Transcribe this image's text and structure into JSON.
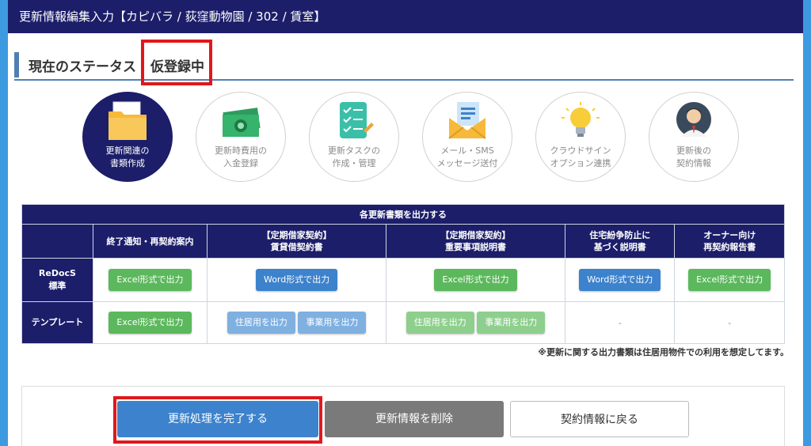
{
  "header": {
    "title": "更新情報編集入力【カピバラ / 荻窪動物園 / 302 / 賃室】"
  },
  "status": {
    "label": "現在のステータス",
    "value": "仮登録中"
  },
  "steps": [
    {
      "line1": "更新関連の",
      "line2": "書類作成",
      "icon": "folder-icon",
      "active": true
    },
    {
      "line1": "更新時費用の",
      "line2": "入金登録",
      "icon": "money-icon"
    },
    {
      "line1": "更新タスクの",
      "line2": "作成・管理",
      "icon": "checklist-icon"
    },
    {
      "line1": "メール・SMS",
      "line2": "メッセージ送付",
      "icon": "mail-icon"
    },
    {
      "line1": "クラウドサイン",
      "line2": "オプション連携",
      "icon": "lightbulb-icon"
    },
    {
      "line1": "更新後の",
      "line2": "契約情報",
      "icon": "person-icon"
    }
  ],
  "table": {
    "caption": "各更新書類を出力する",
    "columns": [
      {
        "line1": "終了通知・再契約案内",
        "line2": ""
      },
      {
        "line1": "【定期借家契約】",
        "line2": "賃貸借契約書"
      },
      {
        "line1": "【定期借家契約】",
        "line2": "重要事項説明書"
      },
      {
        "line1": "住宅紛争防止に",
        "line2": "基づく説明書"
      },
      {
        "line1": "オーナー向け",
        "line2": "再契約報告書"
      }
    ],
    "rows": [
      {
        "head1": "ReDocS",
        "head2": "標準",
        "cells": [
          "Excel形式で出力",
          "Word形式で出力",
          "Excel形式で出力",
          "Word形式で出力",
          "Excel形式で出力"
        ]
      },
      {
        "head1": "テンプレート",
        "head2": "",
        "c1": "Excel形式で出力",
        "c2a": "住居用を出力",
        "c2b": "事業用を出力",
        "c3a": "住居用を出力",
        "c3b": "事業用を出力",
        "c4": "-",
        "c5": "-"
      }
    ],
    "note": "※更新に関する出力書類は住居用物件での利用を想定してます。"
  },
  "footer": {
    "complete": "更新処理を完了する",
    "delete": "更新情報を削除",
    "back": "契約情報に戻る"
  },
  "colors": {
    "navy": "#1c1e6a",
    "accent_red": "#e0181b",
    "green": "#5cb85c",
    "blue": "#3d82cc"
  }
}
